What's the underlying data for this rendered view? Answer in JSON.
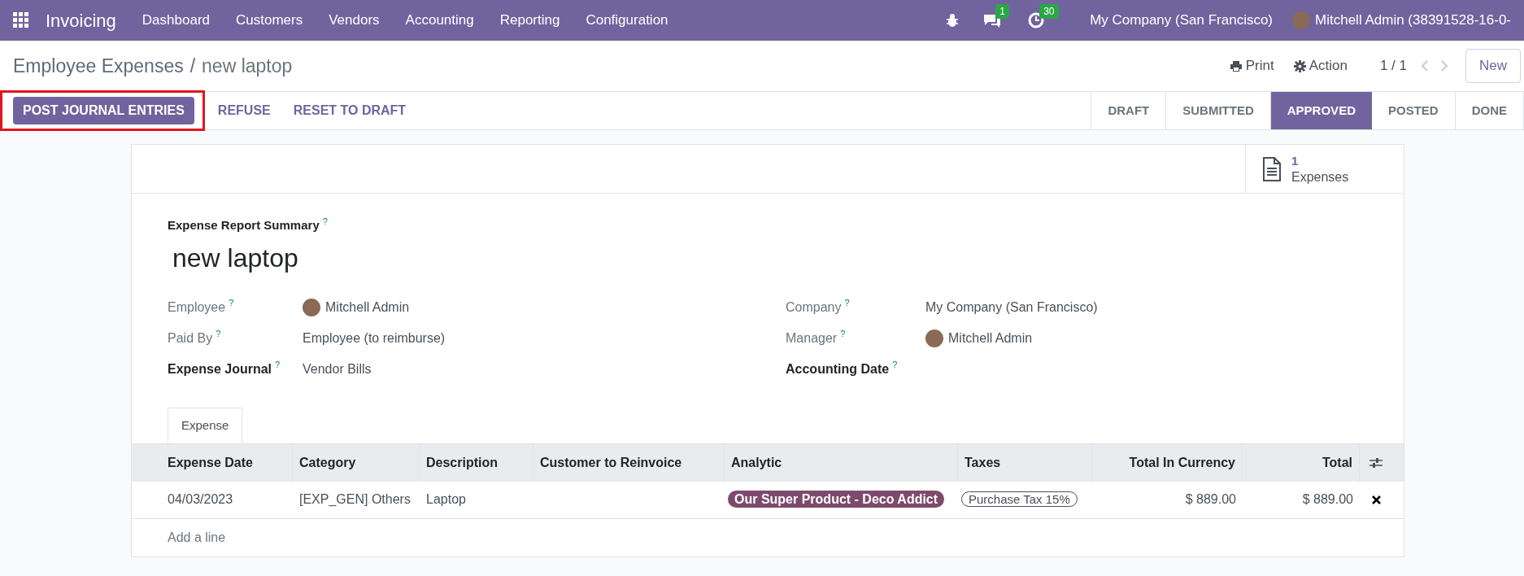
{
  "navbar": {
    "app_name": "Invoicing",
    "menu": [
      "Dashboard",
      "Customers",
      "Vendors",
      "Accounting",
      "Reporting",
      "Configuration"
    ],
    "messages_count": "1",
    "activities_count": "30",
    "company": "My Company (San Francisco)",
    "user": "Mitchell Admin (38391528-16-0-"
  },
  "breadcrumb": {
    "parent": "Employee Expenses",
    "separator": "/",
    "current": "new laptop"
  },
  "control_panel": {
    "print": "Print",
    "action": "Action",
    "pager": "1 / 1",
    "new_button": "New"
  },
  "actions": [
    {
      "label": "POST JOURNAL ENTRIES",
      "primary": true,
      "highlighted": true
    },
    {
      "label": "REFUSE",
      "primary": false,
      "highlighted": false
    },
    {
      "label": "RESET TO DRAFT",
      "primary": false,
      "highlighted": false
    }
  ],
  "stages": [
    {
      "label": "DRAFT",
      "selected": false
    },
    {
      "label": "SUBMITTED",
      "selected": false
    },
    {
      "label": "APPROVED",
      "selected": true
    },
    {
      "label": "POSTED",
      "selected": false
    },
    {
      "label": "DONE",
      "selected": false
    }
  ],
  "smart_button": {
    "count": "1",
    "label": "Expenses"
  },
  "summary": {
    "label": "Expense Report Summary",
    "help": "?",
    "value": "new laptop"
  },
  "fields_left": [
    {
      "label": "Employee",
      "help": "?",
      "value": "Mitchell Admin",
      "required": false,
      "avatar": true
    },
    {
      "label": "Paid By",
      "help": "?",
      "value": "Employee (to reimburse)",
      "required": false,
      "avatar": false
    },
    {
      "label": "Expense Journal",
      "help": "?",
      "value": "Vendor Bills",
      "required": true,
      "avatar": false
    }
  ],
  "fields_right": [
    {
      "label": "Company",
      "help": "?",
      "value": "My Company (San Francisco)",
      "required": false,
      "avatar": false
    },
    {
      "label": "Manager",
      "help": "?",
      "value": "Mitchell Admin",
      "required": false,
      "avatar": true
    },
    {
      "label": "Accounting Date",
      "help": "?",
      "required": true,
      "avatar": false
    }
  ],
  "tabs": [
    {
      "label": "Expense",
      "selected": true
    }
  ],
  "table": {
    "columns": [
      "Expense Date",
      "Category",
      "Description",
      "Customer to Reinvoice",
      "Analytic",
      "Taxes",
      "Total In Currency",
      "Total"
    ],
    "rows": [
      {
        "expense_date": "04/03/2023",
        "category": "[EXP_GEN] Others",
        "description": "Laptop",
        "analytic": {
          "label": "Our Super Product - Deco Addict",
          "color": "#7e4a6c"
        },
        "taxes": "Purchase Tax 15%",
        "total_in_currency": "$ 889.00",
        "total": "$ 889.00"
      }
    ],
    "add_line": "Add a line"
  }
}
